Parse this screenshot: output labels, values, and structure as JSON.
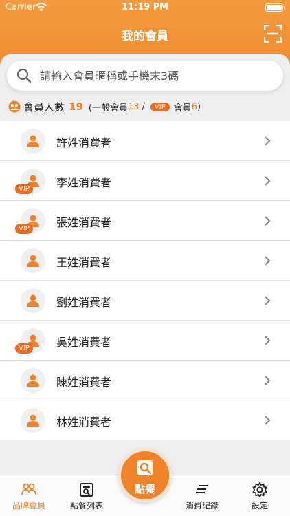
{
  "status_bar": {
    "carrier": "Carrier",
    "time": "11:19 PM"
  },
  "nav": {
    "title": "我的會員"
  },
  "search": {
    "placeholder": "請輸入會員暱稱或手機末3碼"
  },
  "summary": {
    "label": "會員人數",
    "total": "19",
    "general_prefix": "(一般會員",
    "general_count": "13",
    "separator": "/",
    "vip_badge": "VIP",
    "vip_label": "會員",
    "vip_count": "6",
    "close_paren": ")"
  },
  "members": [
    {
      "name": "許姓消費者",
      "vip": false,
      "vip_label": ""
    },
    {
      "name": "李姓消費者",
      "vip": true,
      "vip_label": "VIP"
    },
    {
      "name": "張姓消費者",
      "vip": true,
      "vip_label": "VIP"
    },
    {
      "name": "王姓消費者",
      "vip": false,
      "vip_label": ""
    },
    {
      "name": "劉姓消費者",
      "vip": false,
      "vip_label": ""
    },
    {
      "name": "吳姓消費者",
      "vip": true,
      "vip_label": "VIP"
    },
    {
      "name": "陳姓消費者",
      "vip": false,
      "vip_label": ""
    },
    {
      "name": "林姓消費者",
      "vip": false,
      "vip_label": ""
    }
  ],
  "tabbar": {
    "brand_members": "品牌會員",
    "order_list": "點餐列表",
    "order": "點餐",
    "consumption_records": "消費紀錄",
    "settings": "設定"
  },
  "colors": {
    "accent": "#f0822a",
    "vip": "#ef6a1f"
  }
}
